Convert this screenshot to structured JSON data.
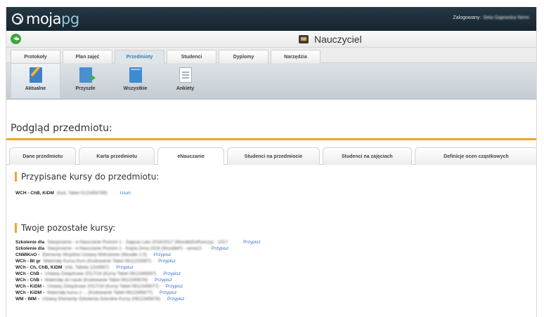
{
  "app": {
    "logo_main": "moja",
    "logo_accent": "pg",
    "login_label": "Zalogowany:",
    "login_user": "Seta Gajewska Nenn"
  },
  "role": {
    "label": "Nauczyciel"
  },
  "menu_tabs": [
    {
      "label": "Protokoły",
      "active": false
    },
    {
      "label": "Plan zajęć",
      "active": false
    },
    {
      "label": "Przedmioty",
      "active": true
    },
    {
      "label": "Studenci",
      "active": false
    },
    {
      "label": "Dyplomy",
      "active": false
    },
    {
      "label": "Narzędzia",
      "active": false
    }
  ],
  "toolbar": [
    {
      "label": "Aktualne",
      "icon": "edit-document-icon",
      "active": true
    },
    {
      "label": "Przyszłe",
      "icon": "document-arrow-icon",
      "active": false
    },
    {
      "label": "Wszystkie",
      "icon": "book-icon",
      "active": false
    },
    {
      "label": "Ankiety",
      "icon": "survey-document-icon",
      "active": false
    }
  ],
  "page_title": "Podgląd przedmiotu:",
  "sub_tabs": [
    {
      "label": "Dane przedmiotu",
      "active": false
    },
    {
      "label": "Karta przedmiotu",
      "active": false
    },
    {
      "label": "eNauczanie",
      "active": true
    },
    {
      "label": "Studenci na przedmiocie",
      "active": false
    },
    {
      "label": "Studenci na zajęciach",
      "active": false
    },
    {
      "label": "Definicje ocen cząstkowych",
      "active": false
    }
  ],
  "assigned": {
    "title": "Przypisane kursy do przedmiotu:",
    "row": {
      "code": "WCH - ChB, KiDM",
      "detail": "(kod, Tabel 0123456789)",
      "action": "Usuń"
    }
  },
  "other": {
    "title": "Twoje pozostałe kursy:",
    "rows": [
      {
        "code": "Szkolenie dla",
        "detail": "Stacjonarne - e-Nauczanie Poziom 1 - Zajęcia Lato 2016/2017 (MoodleDoRzeczy) - 1017",
        "action": "Przypisz"
      },
      {
        "code": "Szkolenie dla",
        "detail": "Stacjonarne - e-Nauczanie Poziom 1 - Kopia Zima 2016 (MoodleP) - seria12",
        "action": "Przypisz"
      },
      {
        "code": "CNMIKnO -",
        "detail": "Elementy Wspólne Ustawy Wdrożenie (Moodle 2.0)",
        "action": "Przypisz"
      },
      {
        "code": "WCh - Bt gr",
        "detail": "Materiały Kursu Kurs (Kodowanie Tabel 0611233567)",
        "action": "Przypisz"
      },
      {
        "code": "WCh - Ch, ChB, KiDM",
        "detail": "(mk, Tabela 1234567)",
        "action": "Przypisz"
      },
      {
        "code": "WCh - ChB -",
        "detail": "Ustawy Związkowe 2017/18 (Kursy Tabel 0612345697)",
        "action": "Przypisz"
      },
      {
        "code": "WCh - ChB -",
        "detail": "Materiały do nauki (Kodowanie Tabel 0612345678)",
        "action": "Przypisz"
      },
      {
        "code": "WCh - KiDM -",
        "detail": "Ustawy Związkowe 2017/18 (Kursy Tabel 0612345677)",
        "action": "Przypisz"
      },
      {
        "code": "WCh - KiDM -",
        "detail": "Materiały kursu z ... (Kodowanie Tabel 0612345677)",
        "action": "Przypisz"
      },
      {
        "code": "WM - IMM -",
        "detail": "Ustawy Elementy Szkolenia Szerokie Kursy (0612345678)",
        "action": "Przypisz"
      }
    ]
  },
  "colors": {
    "header_bg": "#1d2e3a",
    "accent_orange": "#f0a52d",
    "link_blue": "#3a6fc2",
    "active_tab_text": "#3b79ad",
    "back_green": "#3ea53a"
  }
}
